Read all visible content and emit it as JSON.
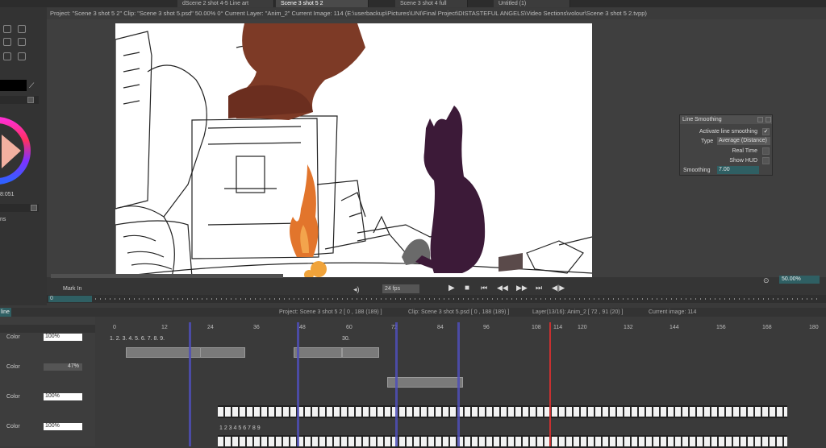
{
  "tabs": [
    {
      "label": "dScene 2 shot 4-5 Line art",
      "active": false
    },
    {
      "label": "Scene 3 shot 5 2",
      "active": true
    },
    {
      "label": "Scene 3 shot 4 full",
      "active": false
    },
    {
      "label": "Untitled (1)",
      "active": false
    }
  ],
  "infobar": "Project: \"Scene 3 shot 5 2\"  Clip: \"Scene 3 shot 5.psd\"  50.00%  0°  Current Layer: \"Anim_2\"  Current Image: 114  (E:\\userbackup\\Pictures\\UNI\\Final Project\\DISTASTEFUL ANGELS\\Video Sections\\volour\\Scene 3 shot 5 2.tvpp)",
  "left_panel": {
    "color_value": "8:051",
    "label_a": "ns"
  },
  "smoothing": {
    "title": "Line Smoothing",
    "activate_label": "Activate line smoothing",
    "activate_checked": "✓",
    "type_label": "Type",
    "type_value": "Average (Distance)",
    "realtime_label": "Real Time",
    "showhud_label": "Show HUD",
    "smoothing_label": "Smoothing",
    "smoothing_value": "7.00"
  },
  "playback": {
    "mark_in": "Mark In",
    "fps": "24 fps",
    "zoom": "50.00%",
    "frame_field": "0"
  },
  "timeline": {
    "tab_label": "line",
    "info_project": "Project: Scene 3 shot 5 2 [ 0 , 188 (189) ]",
    "info_clip": "Clip: Scene 3 shot 5.psd [ 0 , 188 (189) ]",
    "info_layer": "Layer(13/16): Anim_2 [ 72 , 91 (20) ]",
    "info_current": "Current image: 114",
    "ruler": [
      "0",
      "12",
      "24",
      "36",
      "48",
      "60",
      "72",
      "84",
      "96",
      "108",
      "114",
      "120",
      "132",
      "144",
      "156",
      "168",
      "180"
    ],
    "layers": [
      {
        "label": "Color",
        "opacity": "100%"
      },
      {
        "label": "Color",
        "opacity": "47%"
      },
      {
        "label": "Color",
        "opacity": "100%"
      },
      {
        "label": "Color",
        "opacity": "100%"
      }
    ],
    "seq_nums": "1.  2.  3.  4.  5.  6.  7.  8.  9.",
    "seq_30": "30.",
    "seq_bottom": "1  2  3  4  5  6  7  8  9"
  }
}
